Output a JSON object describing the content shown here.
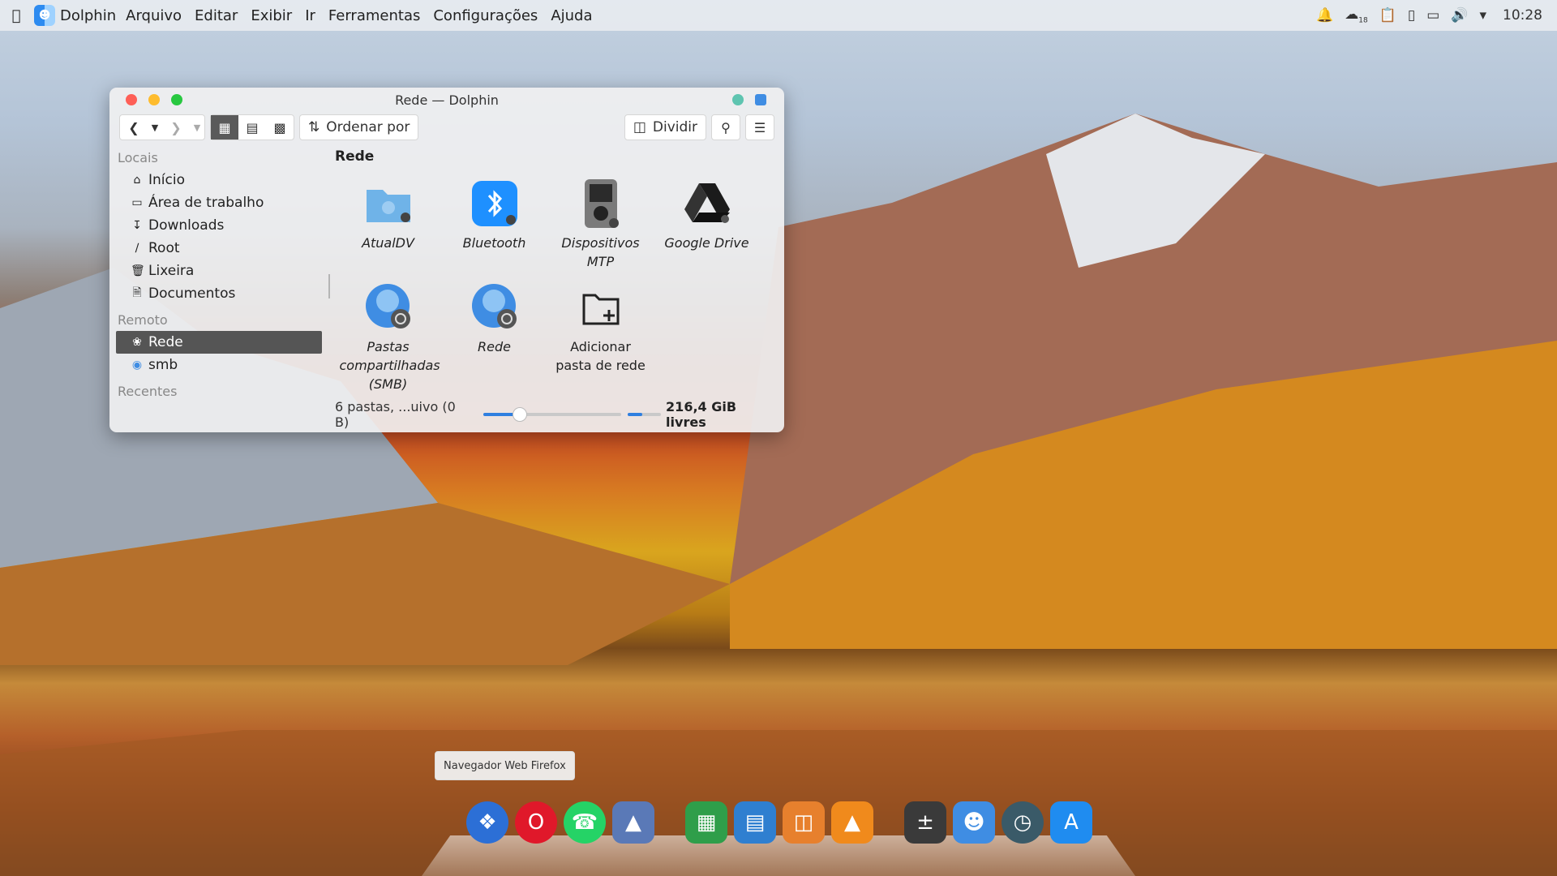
{
  "menubar": {
    "app_name": "Dolphin",
    "menus": [
      "Arquivo",
      "Editar",
      "Exibir",
      "Ir",
      "Ferramentas",
      "Configurações",
      "Ajuda"
    ],
    "clock": "10:28",
    "tray_icons": [
      "notifications-icon",
      "weather-icon",
      "clipboard-icon",
      "battery-device-icon",
      "display-icon",
      "volume-icon",
      "menu-arrow-icon"
    ],
    "weather_temp": "18"
  },
  "window": {
    "title": "Rede — Dolphin",
    "toolbar": {
      "sort_label": "Ordenar por",
      "split_label": "Dividir"
    },
    "sidebar": {
      "sections": [
        {
          "title": "Locais",
          "items": [
            {
              "label": "Início",
              "icon": "home-icon"
            },
            {
              "label": "Área de trabalho",
              "icon": "desktop-icon"
            },
            {
              "label": "Downloads",
              "icon": "download-icon"
            },
            {
              "label": "Root",
              "icon": "root-icon"
            },
            {
              "label": "Lixeira",
              "icon": "trash-icon"
            },
            {
              "label": "Documentos",
              "icon": "document-icon"
            }
          ]
        },
        {
          "title": "Remoto",
          "items": [
            {
              "label": "Rede",
              "icon": "network-icon",
              "selected": true
            },
            {
              "label": "smb",
              "icon": "smb-icon"
            }
          ]
        },
        {
          "title": "Recentes",
          "items": []
        }
      ]
    },
    "breadcrumb": "Rede",
    "items": [
      {
        "label": "AtualDV",
        "icon": "network-folder-icon"
      },
      {
        "label": "Bluetooth",
        "icon": "bluetooth-icon"
      },
      {
        "label": "Dispositivos MTP",
        "icon": "mtp-device-icon"
      },
      {
        "label": "Google Drive",
        "icon": "google-drive-icon"
      },
      {
        "label": "Pastas compartilhadas (SMB)",
        "icon": "smb-share-icon"
      },
      {
        "label": "Rede",
        "icon": "network-globe-icon"
      },
      {
        "label": "Adicionar pasta de rede",
        "icon": "add-network-folder-icon"
      }
    ],
    "status": {
      "summary": "6 pastas, ...uivo (0 B)",
      "free_space": "216,4 GiB livres",
      "zoom_fraction": 0.26,
      "space_used_fraction": 0.45
    }
  },
  "tooltip": "Navegador Web Firefox",
  "dock": [
    {
      "name": "safari-icon",
      "color": "#2c6fd6"
    },
    {
      "name": "opera-icon",
      "color": "#e0182a"
    },
    {
      "name": "whatsapp-icon",
      "color": "#25d366"
    },
    {
      "name": "photo-app-icon",
      "color": "#5a79b7"
    },
    {
      "name": "spreadsheet-icon",
      "color": "#2f9e4a"
    },
    {
      "name": "writer-icon",
      "color": "#2f7fd0"
    },
    {
      "name": "presentation-icon",
      "color": "#e7802d"
    },
    {
      "name": "vlc-icon",
      "color": "#f08a1c"
    },
    {
      "name": "calculator-icon",
      "color": "#3a3a3a"
    },
    {
      "name": "finder-icon",
      "color": "#3f8de3"
    },
    {
      "name": "time-machine-icon",
      "color": "#3a5a68"
    },
    {
      "name": "app-store-icon",
      "color": "#1f8cf0"
    }
  ]
}
